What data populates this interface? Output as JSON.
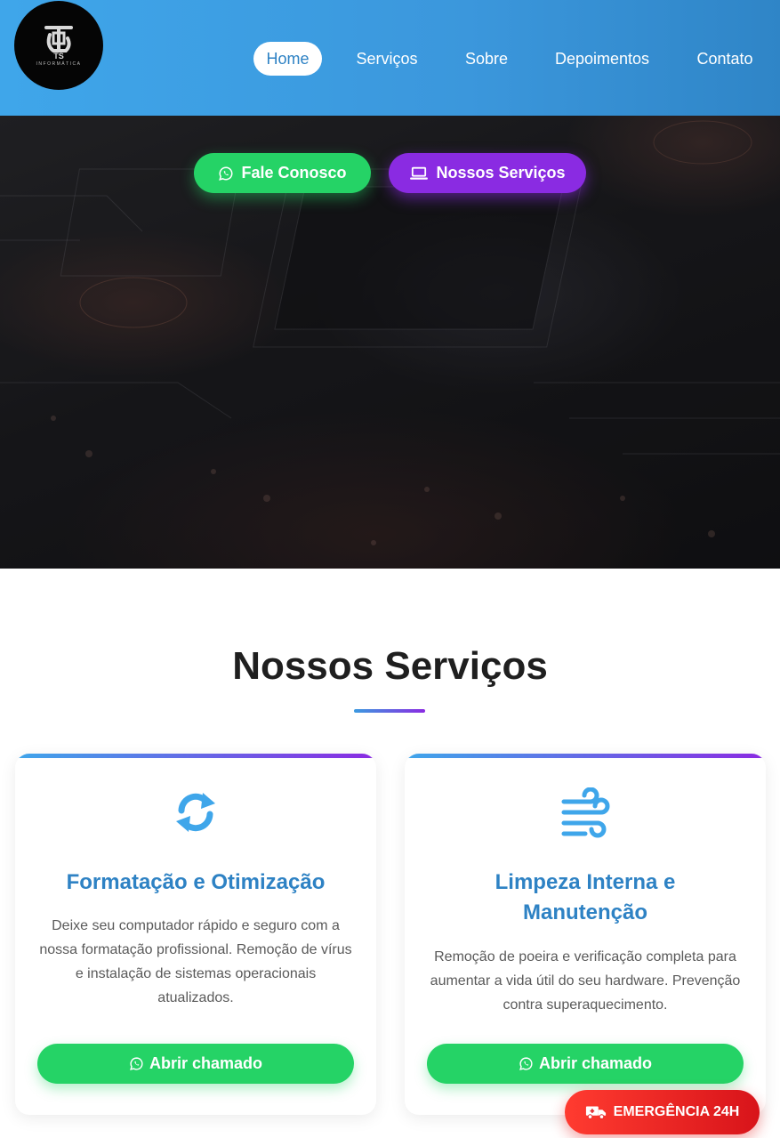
{
  "brand": {
    "logo_text": "TS",
    "logo_subtext": "INFORMÁTICA"
  },
  "nav": {
    "items": [
      {
        "label": "Home",
        "active": true
      },
      {
        "label": "Serviços",
        "active": false
      },
      {
        "label": "Sobre",
        "active": false
      },
      {
        "label": "Depoimentos",
        "active": false
      },
      {
        "label": "Contato",
        "active": false
      }
    ]
  },
  "hero": {
    "primary_button": {
      "label": "Fale Conosco",
      "icon": "whatsapp-icon"
    },
    "secondary_button": {
      "label": "Nossos Serviços",
      "icon": "laptop-icon"
    }
  },
  "services": {
    "title": "Nossos Serviços",
    "cards": [
      {
        "icon": "sync-icon",
        "title": "Formatação e Otimização",
        "description": "Deixe seu computador rápido e seguro com a nossa formatação profissional. Remoção de vírus e instalação de sistemas operacionais atualizados.",
        "button_label": "Abrir chamado"
      },
      {
        "icon": "wind-icon",
        "title": "Limpeza Interna e Manutenção",
        "description": "Remoção de poeira e verificação completa para aumentar a vida útil do seu hardware. Prevenção contra superaquecimento.",
        "button_label": "Abrir chamado"
      }
    ]
  },
  "emergency": {
    "label": "EMERGÊNCIA 24H",
    "icon": "truck-icon"
  },
  "colors": {
    "header_blue": "#3b97dc",
    "accent_blue": "#2e82c4",
    "whatsapp_green": "#25d366",
    "purple": "#8a2be2",
    "emergency_red": "#ff3b30"
  }
}
